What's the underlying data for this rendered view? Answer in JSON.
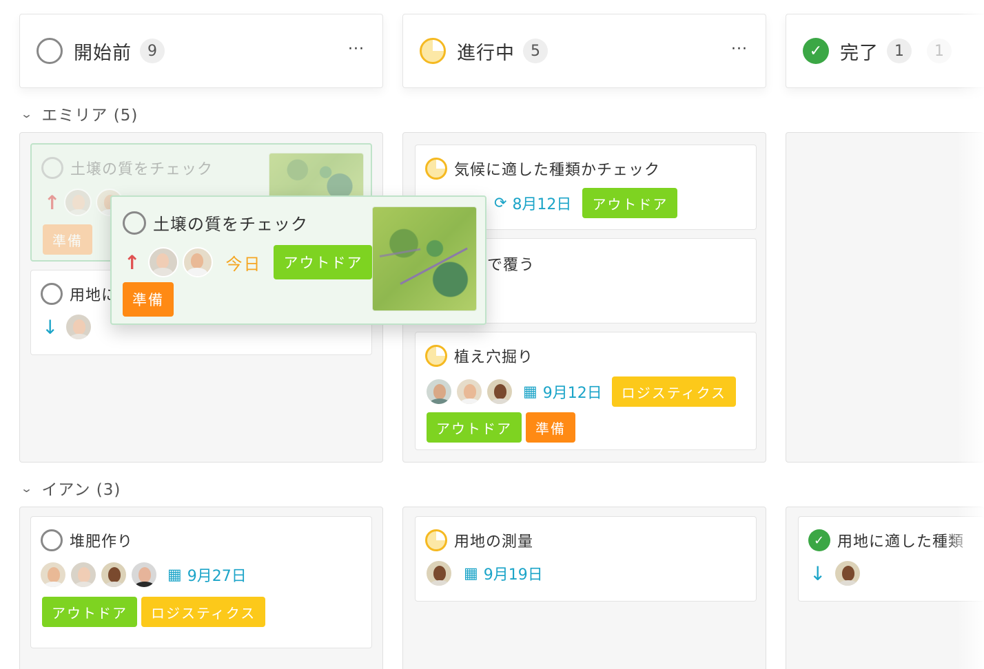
{
  "columns": [
    {
      "title": "開始前",
      "count": "9",
      "more": "···"
    },
    {
      "title": "進行中",
      "count": "5",
      "more": "···"
    },
    {
      "title": "完了",
      "count": "1",
      "extra": "1"
    }
  ],
  "groups": [
    {
      "label": "エミリア (5)"
    },
    {
      "label": "イアン (3)"
    }
  ],
  "emilia": {
    "ghost_card": {
      "title": "土壌の質をチェック",
      "tag": "準備"
    },
    "drag_card": {
      "title": "土壌の質をチェック",
      "due": "今日",
      "tags": [
        "アウトドア",
        "準備"
      ]
    },
    "card_site": {
      "title": "用地に"
    },
    "prog_card1": {
      "title": "気候に適した種類かチェック",
      "date": "8月12日",
      "tags": [
        "アウトドア"
      ]
    },
    "prog_card2": {
      "title": "で覆う"
    },
    "prog_card3": {
      "title": "植え穴掘り",
      "date": "9月12日",
      "tags": [
        "ロジスティクス",
        "アウトドア",
        "準備"
      ]
    }
  },
  "ian": {
    "card1": {
      "title": "堆肥作り",
      "date": "9月27日",
      "tags": [
        "アウトドア",
        "ロジスティクス"
      ]
    },
    "card2": {
      "title": "用地の測量",
      "date": "9月19日"
    },
    "card3": {
      "title": "用地に適した種類"
    }
  },
  "colors": {
    "green": "#7ed321",
    "yellow": "#fcc91a",
    "orange": "#ff8a14",
    "blue": "#1ba4c8",
    "done": "#3ba745"
  }
}
